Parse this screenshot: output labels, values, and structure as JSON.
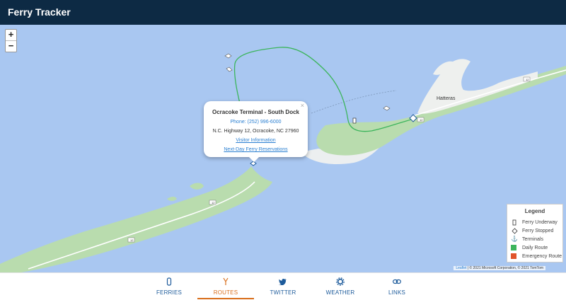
{
  "app": {
    "title": "Ferry Tracker"
  },
  "map": {
    "zoom_in_label": "+",
    "zoom_out_label": "−",
    "place_label": "Hatteras",
    "road_number": "12",
    "water_color": "#a9c7f1",
    "land_color": "#b9dcae",
    "route_color": "#3cb55c"
  },
  "popup": {
    "close_label": "×",
    "title": "Ocracoke Terminal - South Dock",
    "phone": "Phone: (252) 996-6000",
    "address": "N.C. Highway 12, Ocracoke, NC 27960",
    "link1": "Visitor Information",
    "link2": "Next-Day Ferry Reservations"
  },
  "legend": {
    "title": "Legend",
    "items": [
      {
        "icon": "ferry-underway-icon",
        "label": "Ferry Underway"
      },
      {
        "icon": "ferry-stopped-icon",
        "label": "Ferry Stopped"
      },
      {
        "icon": "terminal-icon",
        "label": "Terminals"
      },
      {
        "icon": "swatch",
        "color": "#3cb55c",
        "label": "Daily Route"
      },
      {
        "icon": "swatch",
        "color": "#e0542b",
        "label": "Emergency Route"
      }
    ]
  },
  "attribution": {
    "leaflet": "Leaflet",
    "text": "| © 2021 Microsoft Corporation, © 2021 TomTom"
  },
  "nav": {
    "tabs": [
      {
        "label": "FERRIES",
        "icon": "ferry-icon"
      },
      {
        "label": "ROUTES",
        "icon": "routes-icon",
        "active": true
      },
      {
        "label": "TWITTER",
        "icon": "twitter-icon"
      },
      {
        "label": "WEATHER",
        "icon": "weather-gear-icon"
      },
      {
        "label": "LINKS",
        "icon": "link-icon"
      }
    ]
  }
}
